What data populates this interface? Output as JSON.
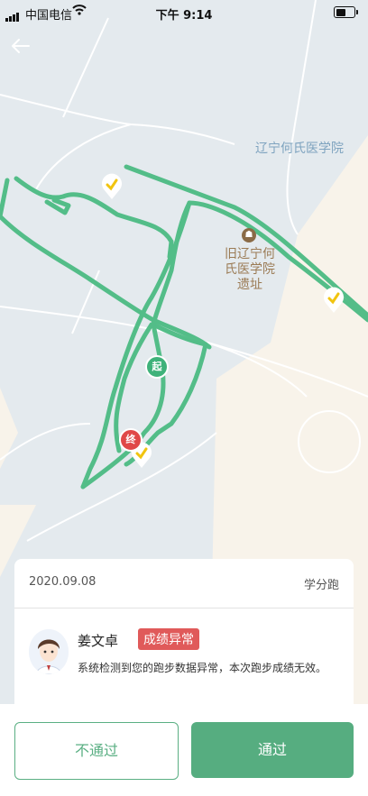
{
  "status_bar": {
    "carrier": "中国电信",
    "time": "下午 9:14"
  },
  "map": {
    "places": [
      {
        "label": "辽宁何氏医学院"
      },
      {
        "label": "旧辽宁何氏医学院遗址"
      }
    ],
    "markers": {
      "start": "起",
      "end": "终"
    },
    "colors": {
      "route": "#4cbb83",
      "road": "#ffffff",
      "land": "#f8f3ea",
      "water": "#e3e9ee"
    }
  },
  "record": {
    "date": "2020.09.08",
    "type": "学分跑",
    "user_name": "姜文卓",
    "badge": "成绩异常",
    "message": "系统检测到您的跑步数据异常，本次跑步成绩无效。"
  },
  "actions": {
    "reject_label": "不通过",
    "approve_label": "通过"
  }
}
